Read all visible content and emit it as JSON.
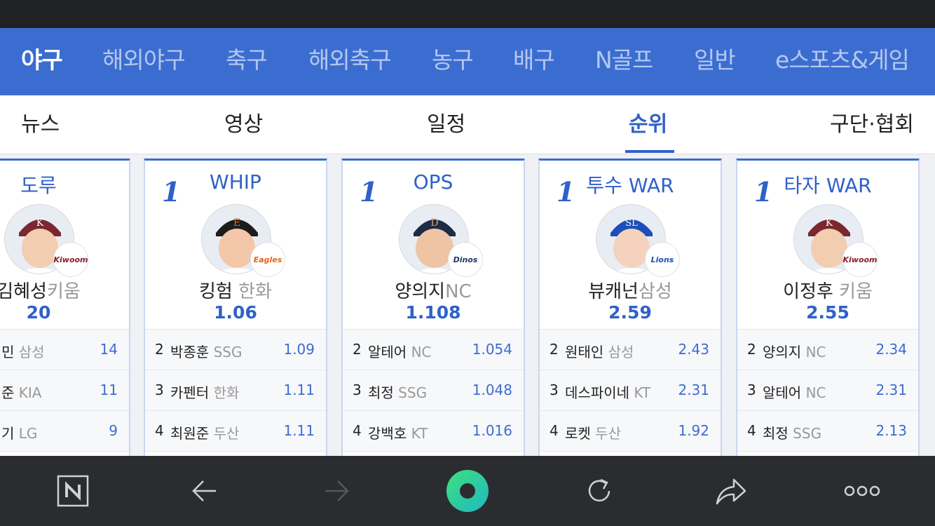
{
  "sport_nav": {
    "items": [
      "야구",
      "해외야구",
      "축구",
      "해외축구",
      "농구",
      "배구",
      "N골프",
      "일반",
      "e스포츠&게임"
    ],
    "active": "야구"
  },
  "sub_nav": {
    "items": [
      "뉴스",
      "영상",
      "일정",
      "순위",
      "구단·협회"
    ],
    "active": "순위"
  },
  "cards": [
    {
      "title": "도루",
      "leader": {
        "name": "김혜성",
        "team": "키움",
        "value": "20",
        "logo": "Kiwoom"
      },
      "rows": [
        {
          "rank": "",
          "name": "민",
          "team": "삼성",
          "value": "14"
        },
        {
          "rank": "",
          "name": "준",
          "team": "KIA",
          "value": "11"
        },
        {
          "rank": "",
          "name": "기",
          "team": "LG",
          "value": "9"
        }
      ]
    },
    {
      "rank": "1",
      "title": "WHIP",
      "leader": {
        "name": "킹험",
        "team": "한화",
        "value": "1.06",
        "logo": "Eagles"
      },
      "rows": [
        {
          "rank": "2",
          "name": "박종훈",
          "team": "SSG",
          "value": "1.09"
        },
        {
          "rank": "3",
          "name": "카펜터",
          "team": "한화",
          "value": "1.11"
        },
        {
          "rank": "4",
          "name": "최원준",
          "team": "두산",
          "value": "1.11"
        }
      ]
    },
    {
      "rank": "1",
      "title": "OPS",
      "leader": {
        "name": "양의지",
        "team": "NC",
        "value": "1.108",
        "logo": "Dinos"
      },
      "rows": [
        {
          "rank": "2",
          "name": "알테어",
          "team": "NC",
          "value": "1.054"
        },
        {
          "rank": "3",
          "name": "최정",
          "team": "SSG",
          "value": "1.048"
        },
        {
          "rank": "4",
          "name": "강백호",
          "team": "KT",
          "value": "1.016"
        }
      ]
    },
    {
      "rank": "1",
      "title": "투수 WAR",
      "leader": {
        "name": "뷰캐넌",
        "team": "삼성",
        "value": "2.59",
        "logo": "Lions"
      },
      "rows": [
        {
          "rank": "2",
          "name": "원태인",
          "team": "삼성",
          "value": "2.43"
        },
        {
          "rank": "3",
          "name": "데스파이네",
          "team": "KT",
          "value": "2.31"
        },
        {
          "rank": "4",
          "name": "로켓",
          "team": "두산",
          "value": "1.92"
        }
      ]
    },
    {
      "rank": "1",
      "title": "타자 WAR",
      "leader": {
        "name": "이정후",
        "team": "키움",
        "value": "2.55",
        "logo": "Kiwoom"
      },
      "rows": [
        {
          "rank": "2",
          "name": "양의지",
          "team": "NC",
          "value": "2.34"
        },
        {
          "rank": "3",
          "name": "알테어",
          "team": "NC",
          "value": "2.31"
        },
        {
          "rank": "4",
          "name": "최정",
          "team": "SSG",
          "value": "2.13"
        }
      ]
    }
  ],
  "colors": {
    "accent": "#3b6dd1",
    "nav_bg": "#3b6dd1",
    "bottom_bar": "#2b2c30"
  },
  "toolbar": {
    "icons": [
      "naver-home-icon",
      "back-arrow-icon",
      "forward-arrow-icon",
      "green-dot-icon",
      "refresh-icon",
      "share-icon",
      "more-icon"
    ]
  }
}
